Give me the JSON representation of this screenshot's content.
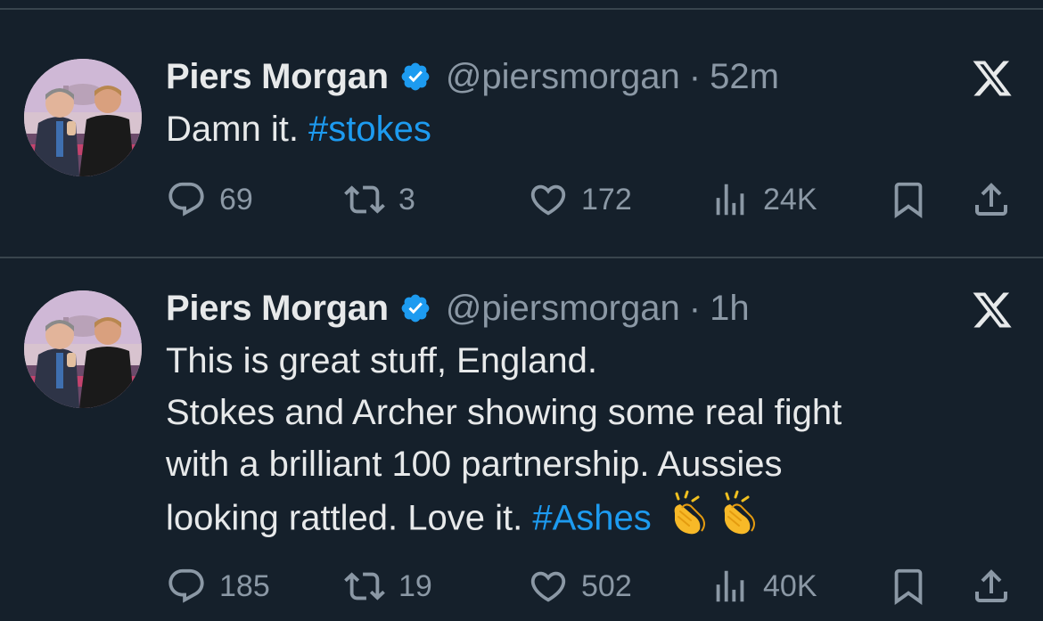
{
  "tweets": [
    {
      "author": {
        "name": "Piers Morgan",
        "handle": "@piersmorgan",
        "verified": true
      },
      "separator": "·",
      "time": "52m",
      "text_segments": [
        {
          "text": "Damn it. ",
          "type": "plain"
        },
        {
          "text": "#stokes",
          "type": "hashtag"
        }
      ],
      "stats": {
        "replies": "69",
        "retweets": "3",
        "likes": "172",
        "views": "24K"
      }
    },
    {
      "author": {
        "name": "Piers Morgan",
        "handle": "@piersmorgan",
        "verified": true
      },
      "separator": "·",
      "time": "1h",
      "lines": [
        "This is great stuff, England.",
        "Stokes and Archer showing some real fight",
        "with a brilliant 100 partnership. Aussies",
        "looking rattled. Love it. "
      ],
      "hashtag": "#Ashes",
      "emojis": [
        "clapping-hands",
        "clapping-hands"
      ],
      "stats": {
        "replies": "185",
        "retweets": "19",
        "likes": "502",
        "views": "40K"
      }
    }
  ],
  "colors": {
    "background": "#15202b",
    "divider": "#38444d",
    "text": "#e7e9ea",
    "muted": "#8b98a5",
    "accent": "#1d9bf0"
  },
  "icons": {
    "reply": "reply-icon",
    "retweet": "retweet-icon",
    "like": "like-icon",
    "views": "views-icon",
    "bookmark": "bookmark-icon",
    "share": "share-icon",
    "verified": "verified-badge-icon",
    "x": "x-logo-icon"
  }
}
